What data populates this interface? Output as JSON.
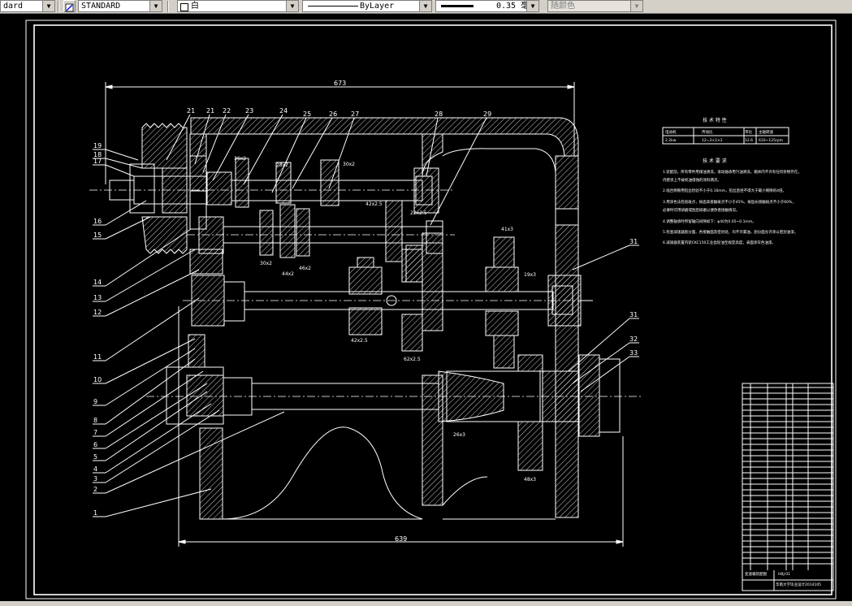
{
  "toolbar": {
    "style_combo": "dard",
    "text_style_combo": "STANDARD",
    "color_combo": "白",
    "linetype_combo": "ByLayer",
    "lineweight_combo": "0.35 毫米",
    "plotstyle_combo": "随颜色"
  },
  "drawing": {
    "dim_overall_top": "673",
    "dim_overall_bottom": "639",
    "part_labels_top": [
      "21",
      "21",
      "22",
      "23",
      "24",
      "25",
      "26",
      "27",
      "28",
      "29"
    ],
    "part_labels_left": [
      "19",
      "18",
      "17",
      "16",
      "15",
      "14",
      "13",
      "12",
      "11",
      "10",
      "9",
      "8",
      "7",
      "6",
      "5",
      "4",
      "3",
      "2",
      "1"
    ],
    "part_labels_right": [
      "31",
      "31",
      "32",
      "33"
    ],
    "gear_notes": [
      "36x2",
      "28x2",
      "30x2",
      "42x2.5",
      "22x2.5",
      "41x3",
      "30x2",
      "44x2",
      "46x2",
      "19x3",
      "42x2.5",
      "62x2.5",
      "26x3",
      "48x3"
    ],
    "tech_table_title": "技 术 特 性",
    "tech_table_headers": [
      "电动机",
      "传动比",
      "带比",
      "主轴转速"
    ],
    "tech_table_values": [
      "2.2kw",
      "12=3×2×2",
      "12.6",
      "610~125rpm"
    ],
    "requirements_title": "技 术 要 求",
    "requirements": [
      "1.装配前，所有零件用煤油清洗，滚动轴承用汽油清洗，箱体内不许有任何杂物存在。",
      "   内壁涂上不被机油侵蚀的涂料两次。",
      "2.啮合侧隙用铅丝检验不小于0.16mm，铅丝直径不得大于最小侧隙的4倍。",
      "3.用涂色法检验斑点，按齿高接触斑点不小于45%，按齿长接触斑点不小于60%，",
      "   必要时可用研磨或刮后研磨以便改善接触情况。",
      "4.调整轴承时所留轴向间隙如下：φ40为0.05~0.1mm。",
      "5.检查减速器剖分面、各接触面及密封处，均不许漏油，剖分面允许涂以密封油漆。",
      "6.减速器装置内装CKC150工业齿轮油至规定高度，表面涂灰色油漆。"
    ],
    "title_block": {
      "school": "华南大学毕业设计2014105",
      "name": "变速箱装配图",
      "drawing_no": "HBJ-01"
    }
  }
}
